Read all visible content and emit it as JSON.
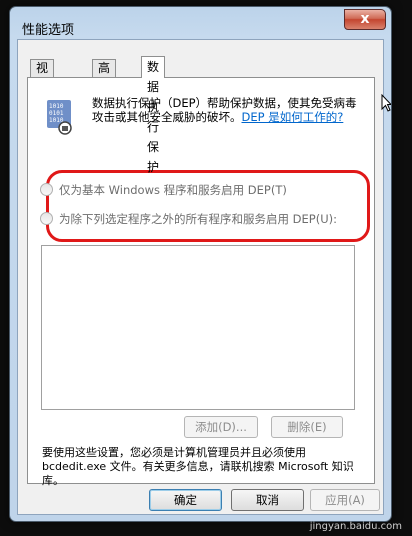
{
  "window": {
    "title": "性能选项",
    "close_glyph": "x"
  },
  "tabs": [
    {
      "label": "视觉效果",
      "active": false
    },
    {
      "label": "高级",
      "active": false
    },
    {
      "label": "数据执行保护",
      "active": true
    }
  ],
  "dep": {
    "description": "数据执行保护（DEP）帮助保护数据，使其免受病毒攻击或其他安全威胁的破坏。",
    "link": "DEP 是如何工作的?",
    "options": [
      {
        "label": "仅为基本 Windows 程序和服务启用 DEP(T)",
        "selected": false
      },
      {
        "label": "为除下列选定程序之外的所有程序和服务启用 DEP(U):",
        "selected": false
      }
    ],
    "add_button": "添加(D)...",
    "remove_button": "删除(E)",
    "note": "要使用这些设置，您必须是计算机管理员并且必须使用 bcdedit.exe 文件。有关更多信息，请联机搜索 Microsoft 知识库。"
  },
  "footer": {
    "ok": "确定",
    "cancel": "取消",
    "apply": "应用(A)"
  },
  "watermark": "jingyan.baidu.com",
  "colors": {
    "highlight": "#e01818",
    "link": "#0066cc"
  }
}
